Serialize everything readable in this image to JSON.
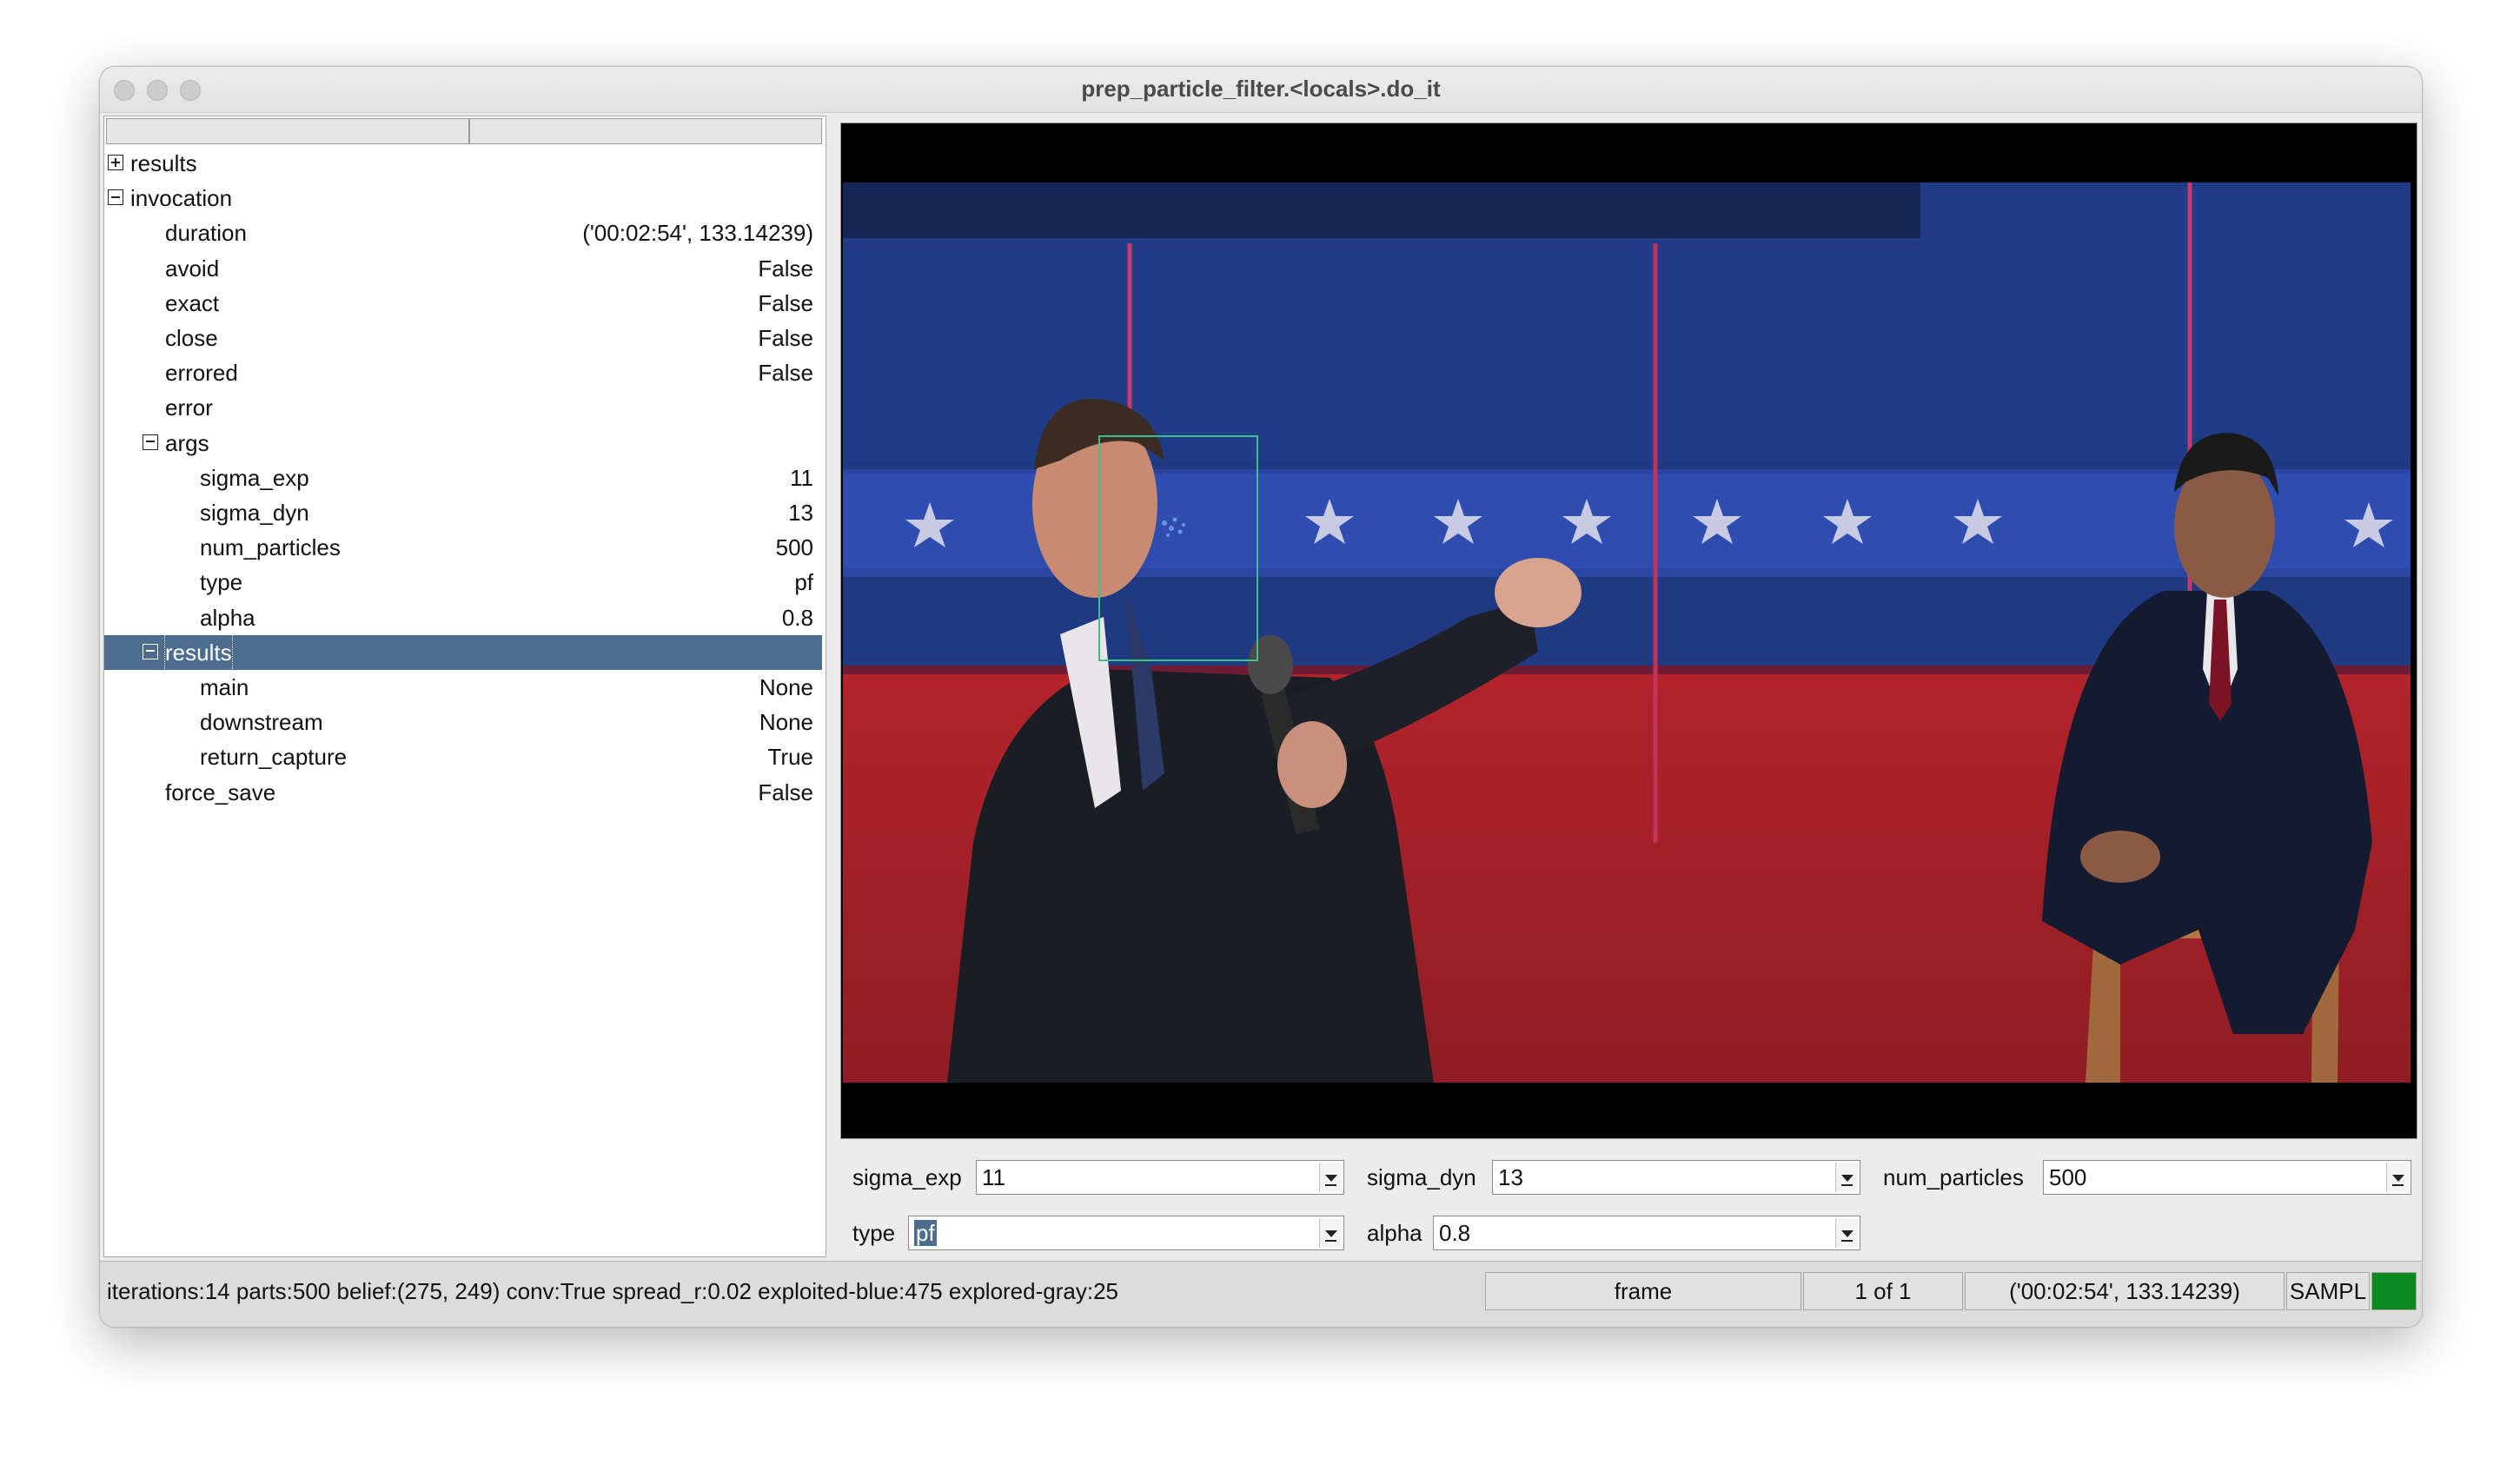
{
  "window": {
    "title": "prep_particle_filter.<locals>.do_it"
  },
  "tree": {
    "rows": [
      {
        "label": "results",
        "value": "",
        "expander": "plus"
      },
      {
        "label": "invocation",
        "value": "",
        "expander": "minus"
      },
      {
        "label": "duration",
        "value": "('00:02:54', 133.14239)"
      },
      {
        "label": "avoid",
        "value": "False"
      },
      {
        "label": "exact",
        "value": "False"
      },
      {
        "label": "close",
        "value": "False"
      },
      {
        "label": "errored",
        "value": "False"
      },
      {
        "label": "error",
        "value": ""
      },
      {
        "label": "args",
        "value": "",
        "expander": "minus"
      },
      {
        "label": "sigma_exp",
        "value": "11"
      },
      {
        "label": "sigma_dyn",
        "value": "13"
      },
      {
        "label": "num_particles",
        "value": "500"
      },
      {
        "label": "type",
        "value": "pf"
      },
      {
        "label": "alpha",
        "value": "0.8"
      },
      {
        "label": "results",
        "value": "",
        "expander": "minus",
        "selected": true
      },
      {
        "label": "main",
        "value": "None"
      },
      {
        "label": "downstream",
        "value": "None"
      },
      {
        "label": "return_capture",
        "value": "True"
      },
      {
        "label": "force_save",
        "value": "False"
      }
    ]
  },
  "controls": {
    "sigma_exp": {
      "label": "sigma_exp",
      "value": "11"
    },
    "sigma_dyn": {
      "label": "sigma_dyn",
      "value": "13"
    },
    "num_particles": {
      "label": "num_particles",
      "value": "500"
    },
    "type": {
      "label": "type",
      "value": "pf"
    },
    "alpha": {
      "label": "alpha",
      "value": "0.8"
    }
  },
  "status": {
    "message": "iterations:14 parts:500 belief:(275, 249) conv:True spread_r:0.02 exploited-blue:475 explored-gray:25",
    "frame_label": "frame",
    "frame_index": "1 of 1",
    "timestamp": "('00:02:54', 133.14239)",
    "mode": "SAMPL",
    "indicator_color": "#0a8a1e"
  },
  "colors": {
    "selection": "#4d6d8f",
    "tracking_box": "#3fbf8f"
  }
}
